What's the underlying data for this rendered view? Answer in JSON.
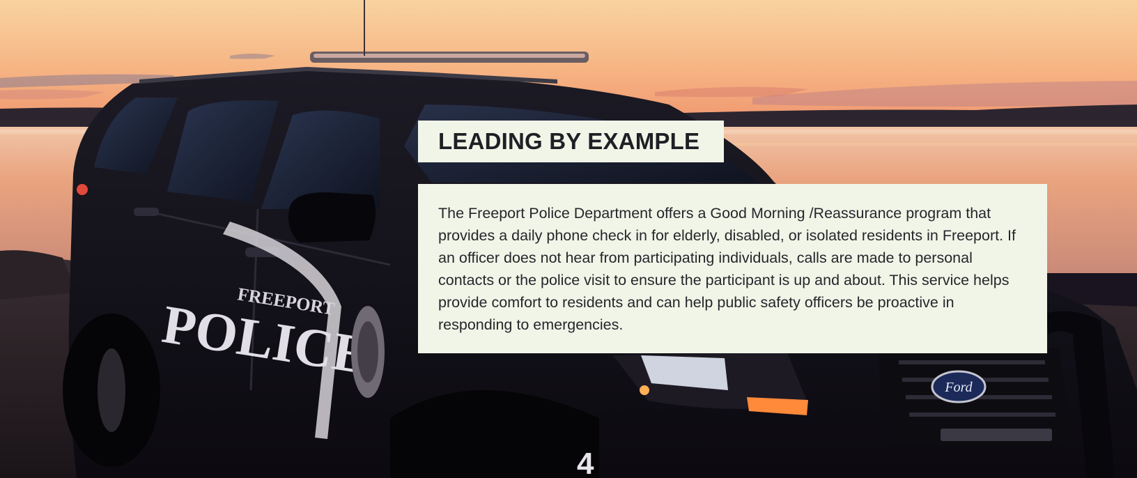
{
  "hero": {
    "heading": "LEADING BY EXAMPLE",
    "body": "The Freeport Police Department offers a Good Morning /Reassurance program that provides a daily phone check in for elderly, disabled, or isolated residents in Freeport. If an officer does not hear from participating individuals, calls are made to personal contacts or the police visit to ensure the participant is up and about. This service helps provide comfort to residents and can help public safety officers be proactive in responding to emergencies.",
    "image": {
      "car_door_text_top": "FREEPORT",
      "car_door_text_main": "POLICE",
      "car_number": "4",
      "grille_badge": "Ford"
    }
  },
  "colors": {
    "panel_background": "#f1f5e8",
    "heading_text": "#1f1f24",
    "body_text": "#26262b",
    "sky_top": "#f7c98f",
    "sky_horizon": "#f39a6c",
    "water": "#e8a078"
  }
}
